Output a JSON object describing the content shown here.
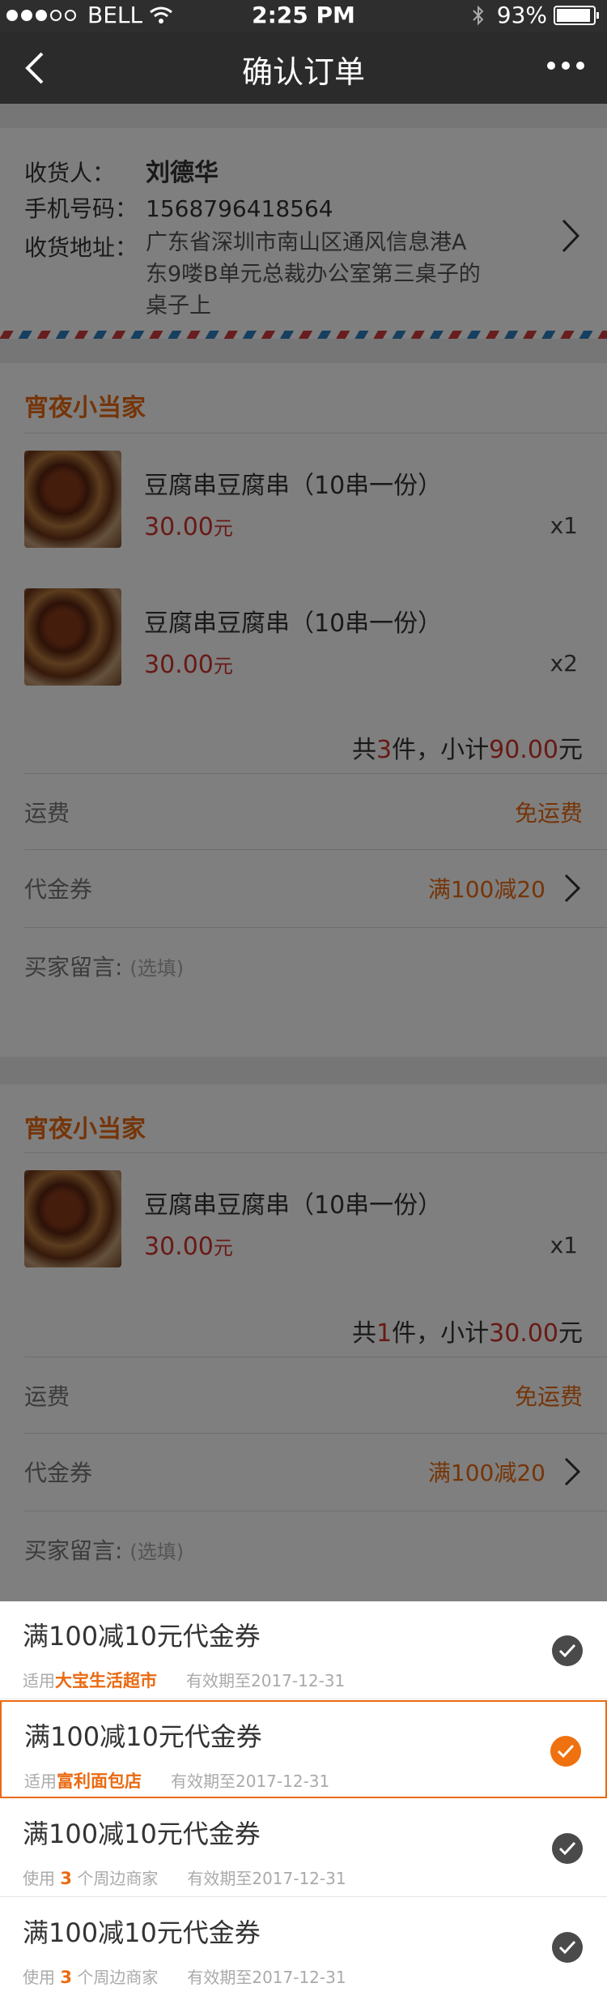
{
  "status_bar": {
    "carrier": "BELL",
    "time": "2:25 PM",
    "battery": "93%",
    "battery_level": 0.93
  },
  "nav": {
    "title": "确认订单"
  },
  "address": {
    "receiver_label": "收货人：",
    "receiver_name": "刘德华",
    "phone_label": "手机号码：",
    "phone": "1568796418564",
    "address_label": "收货地址：",
    "address_text": "广东省深圳市南山区通风信息港A东9喽B单元总裁办公室第三桌子的桌子上"
  },
  "shops": [
    {
      "name": "宵夜小当家",
      "items": [
        {
          "name": "豆腐串豆腐串（10串一份）",
          "price": "30.00",
          "unit": "元",
          "qty": "x1"
        },
        {
          "name": "豆腐串豆腐串（10串一份）",
          "price": "30.00",
          "unit": "元",
          "qty": "x2"
        }
      ],
      "subtotal": {
        "prefix": "共",
        "count": "3",
        "mid": "件，小计",
        "amount": "90.00",
        "suffix": "元"
      },
      "shipping_label": "运费",
      "shipping_value": "免运费",
      "voucher_label": "代金券",
      "voucher_value": "满100减20",
      "message_label": "买家留言:",
      "message_placeholder": "(选填)"
    },
    {
      "name": "宵夜小当家",
      "items": [
        {
          "name": "豆腐串豆腐串（10串一份）",
          "price": "30.00",
          "unit": "元",
          "qty": "x1"
        }
      ],
      "subtotal": {
        "prefix": "共",
        "count": "1",
        "mid": "件，小计",
        "amount": "30.00",
        "suffix": "元"
      },
      "shipping_label": "运费",
      "shipping_value": "免运费",
      "voucher_label": "代金券",
      "voucher_value": "满100减20",
      "message_label": "买家留言:",
      "message_placeholder": "(选填)"
    }
  ],
  "coupons": [
    {
      "title": "满100减10元代金券",
      "scope_prefix": "适用",
      "scope_highlight": "大宝生活超市",
      "scope_suffix": "",
      "expiry": "有效期至2017-12-31",
      "selected": false
    },
    {
      "title": "满100减10元代金券",
      "scope_prefix": "适用",
      "scope_highlight": "富利面包店",
      "scope_suffix": "",
      "expiry": "有效期至2017-12-31",
      "selected": true
    },
    {
      "title": "满100减10元代金券",
      "scope_prefix": "使用 ",
      "scope_highlight": "3",
      "scope_suffix": " 个周边商家",
      "expiry": "有效期至2017-12-31",
      "selected": false
    },
    {
      "title": "满100减10元代金券",
      "scope_prefix": "使用 ",
      "scope_highlight": "3",
      "scope_suffix": " 个周边商家",
      "expiry": "有效期至2017-12-31",
      "selected": false
    }
  ],
  "icons": [
    "back-icon",
    "more-icon",
    "wifi-icon",
    "bluetooth-icon",
    "battery-icon",
    "chevron-right-icon",
    "check-icon"
  ],
  "colors": {
    "accent": "#ea6a12",
    "price": "#d0342c",
    "check_on": "#f0710f",
    "check_off": "#4a4a4a"
  }
}
